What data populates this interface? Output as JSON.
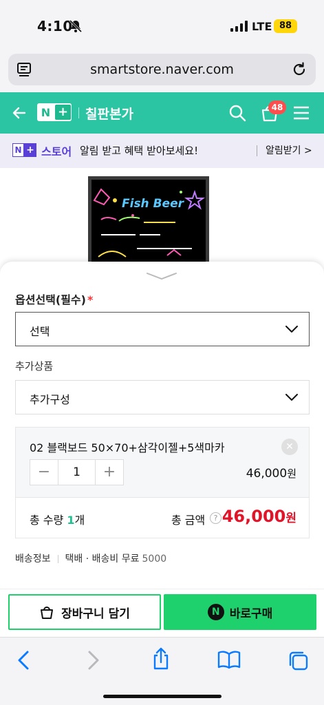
{
  "status_bar": {
    "time": "4:10",
    "network": "LTE",
    "battery": "88"
  },
  "browser": {
    "domain": "smartstore.naver.com"
  },
  "header": {
    "logo_n": "N",
    "logo_plus": "+",
    "store_name": "칠판본가",
    "cart_count": "48"
  },
  "notice": {
    "logo_n": "N",
    "logo_plus": "+",
    "store_label": "스토어",
    "message": "알림 받고 혜택 받아보세요!",
    "action": "알림받기 >"
  },
  "options": {
    "required_label": "옵션선택(필수)",
    "required_mark": "*",
    "select_value": "선택",
    "additional_label": "추가상품",
    "additional_value": "추가구성"
  },
  "selected_item": {
    "name": "02 블랙보드 50×70+삼각이젤+5색마카",
    "quantity": "1",
    "price": "46,000",
    "currency": "원"
  },
  "total": {
    "qty_label": "총 수량",
    "qty_value": "1",
    "qty_unit": "개",
    "amount_label": "총 금액",
    "help": "?",
    "amount": "46,000",
    "currency": "원"
  },
  "shipping": {
    "label": "배송정보",
    "method": "택배 · 배송비 무료",
    "fee": "5000"
  },
  "actions": {
    "cart": "장바구니 담기",
    "buy_icon": "N",
    "buy": "바로구매"
  },
  "colors": {
    "brand_green": "#2cc5a3",
    "npay_green": "#1fd16c",
    "price_red": "#e0152a",
    "plus_purple": "#5a40d6",
    "link_blue": "#0a7aff"
  },
  "icons": [
    "bell-slash-icon",
    "signal-icon",
    "page-icon",
    "reload-icon",
    "back-arrow-icon",
    "search-icon",
    "shopping-bag-icon",
    "menu-icon",
    "chevron-down-icon",
    "close-icon",
    "safari-back-icon",
    "safari-forward-icon",
    "share-icon",
    "bookmarks-icon",
    "tabs-icon"
  ]
}
